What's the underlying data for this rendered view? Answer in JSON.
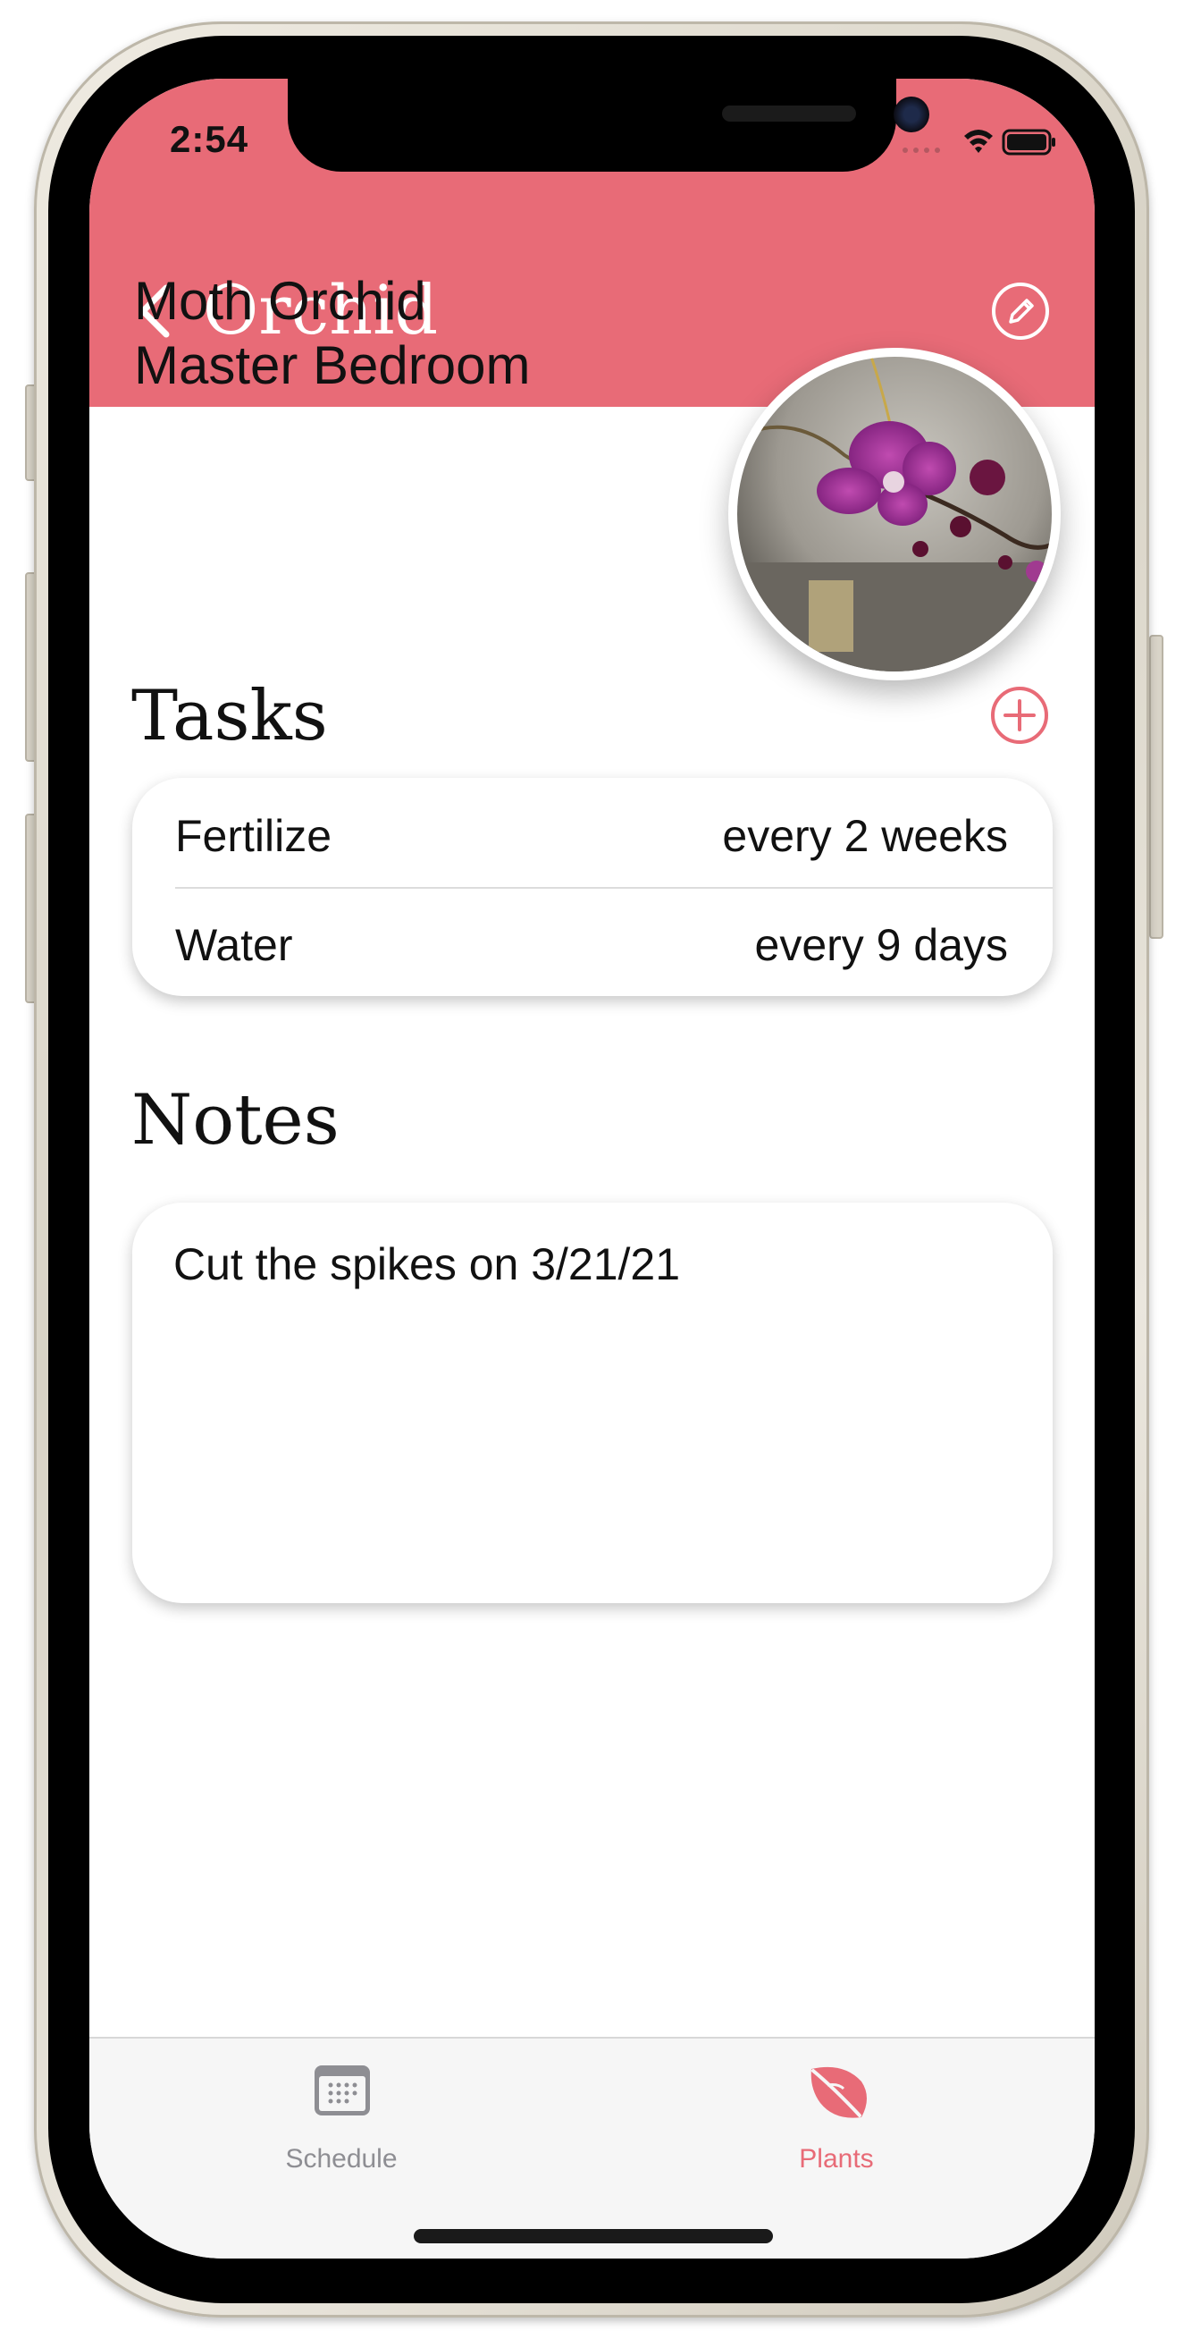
{
  "colors": {
    "accent": "#e86b77",
    "tab_inactive": "#8e8e93"
  },
  "status_bar": {
    "time": "2:54"
  },
  "nav": {
    "title": "Orchid",
    "back_icon": "chevron-left-icon",
    "edit_icon": "pencil-circle-icon"
  },
  "plant": {
    "species": "Moth Orchid",
    "location": "Master Bedroom"
  },
  "tasks": {
    "heading": "Tasks",
    "add_icon": "plus-circle-icon",
    "items": [
      {
        "name": "Fertilize",
        "frequency": "every 2 weeks"
      },
      {
        "name": "Water",
        "frequency": "every 9 days"
      }
    ]
  },
  "notes": {
    "heading": "Notes",
    "text": "Cut the spikes on 3/21/21"
  },
  "tabbar": {
    "items": [
      {
        "label": "Schedule",
        "icon": "calendar-icon",
        "selected": false
      },
      {
        "label": "Plants",
        "icon": "leaf-icon",
        "selected": true
      }
    ]
  }
}
